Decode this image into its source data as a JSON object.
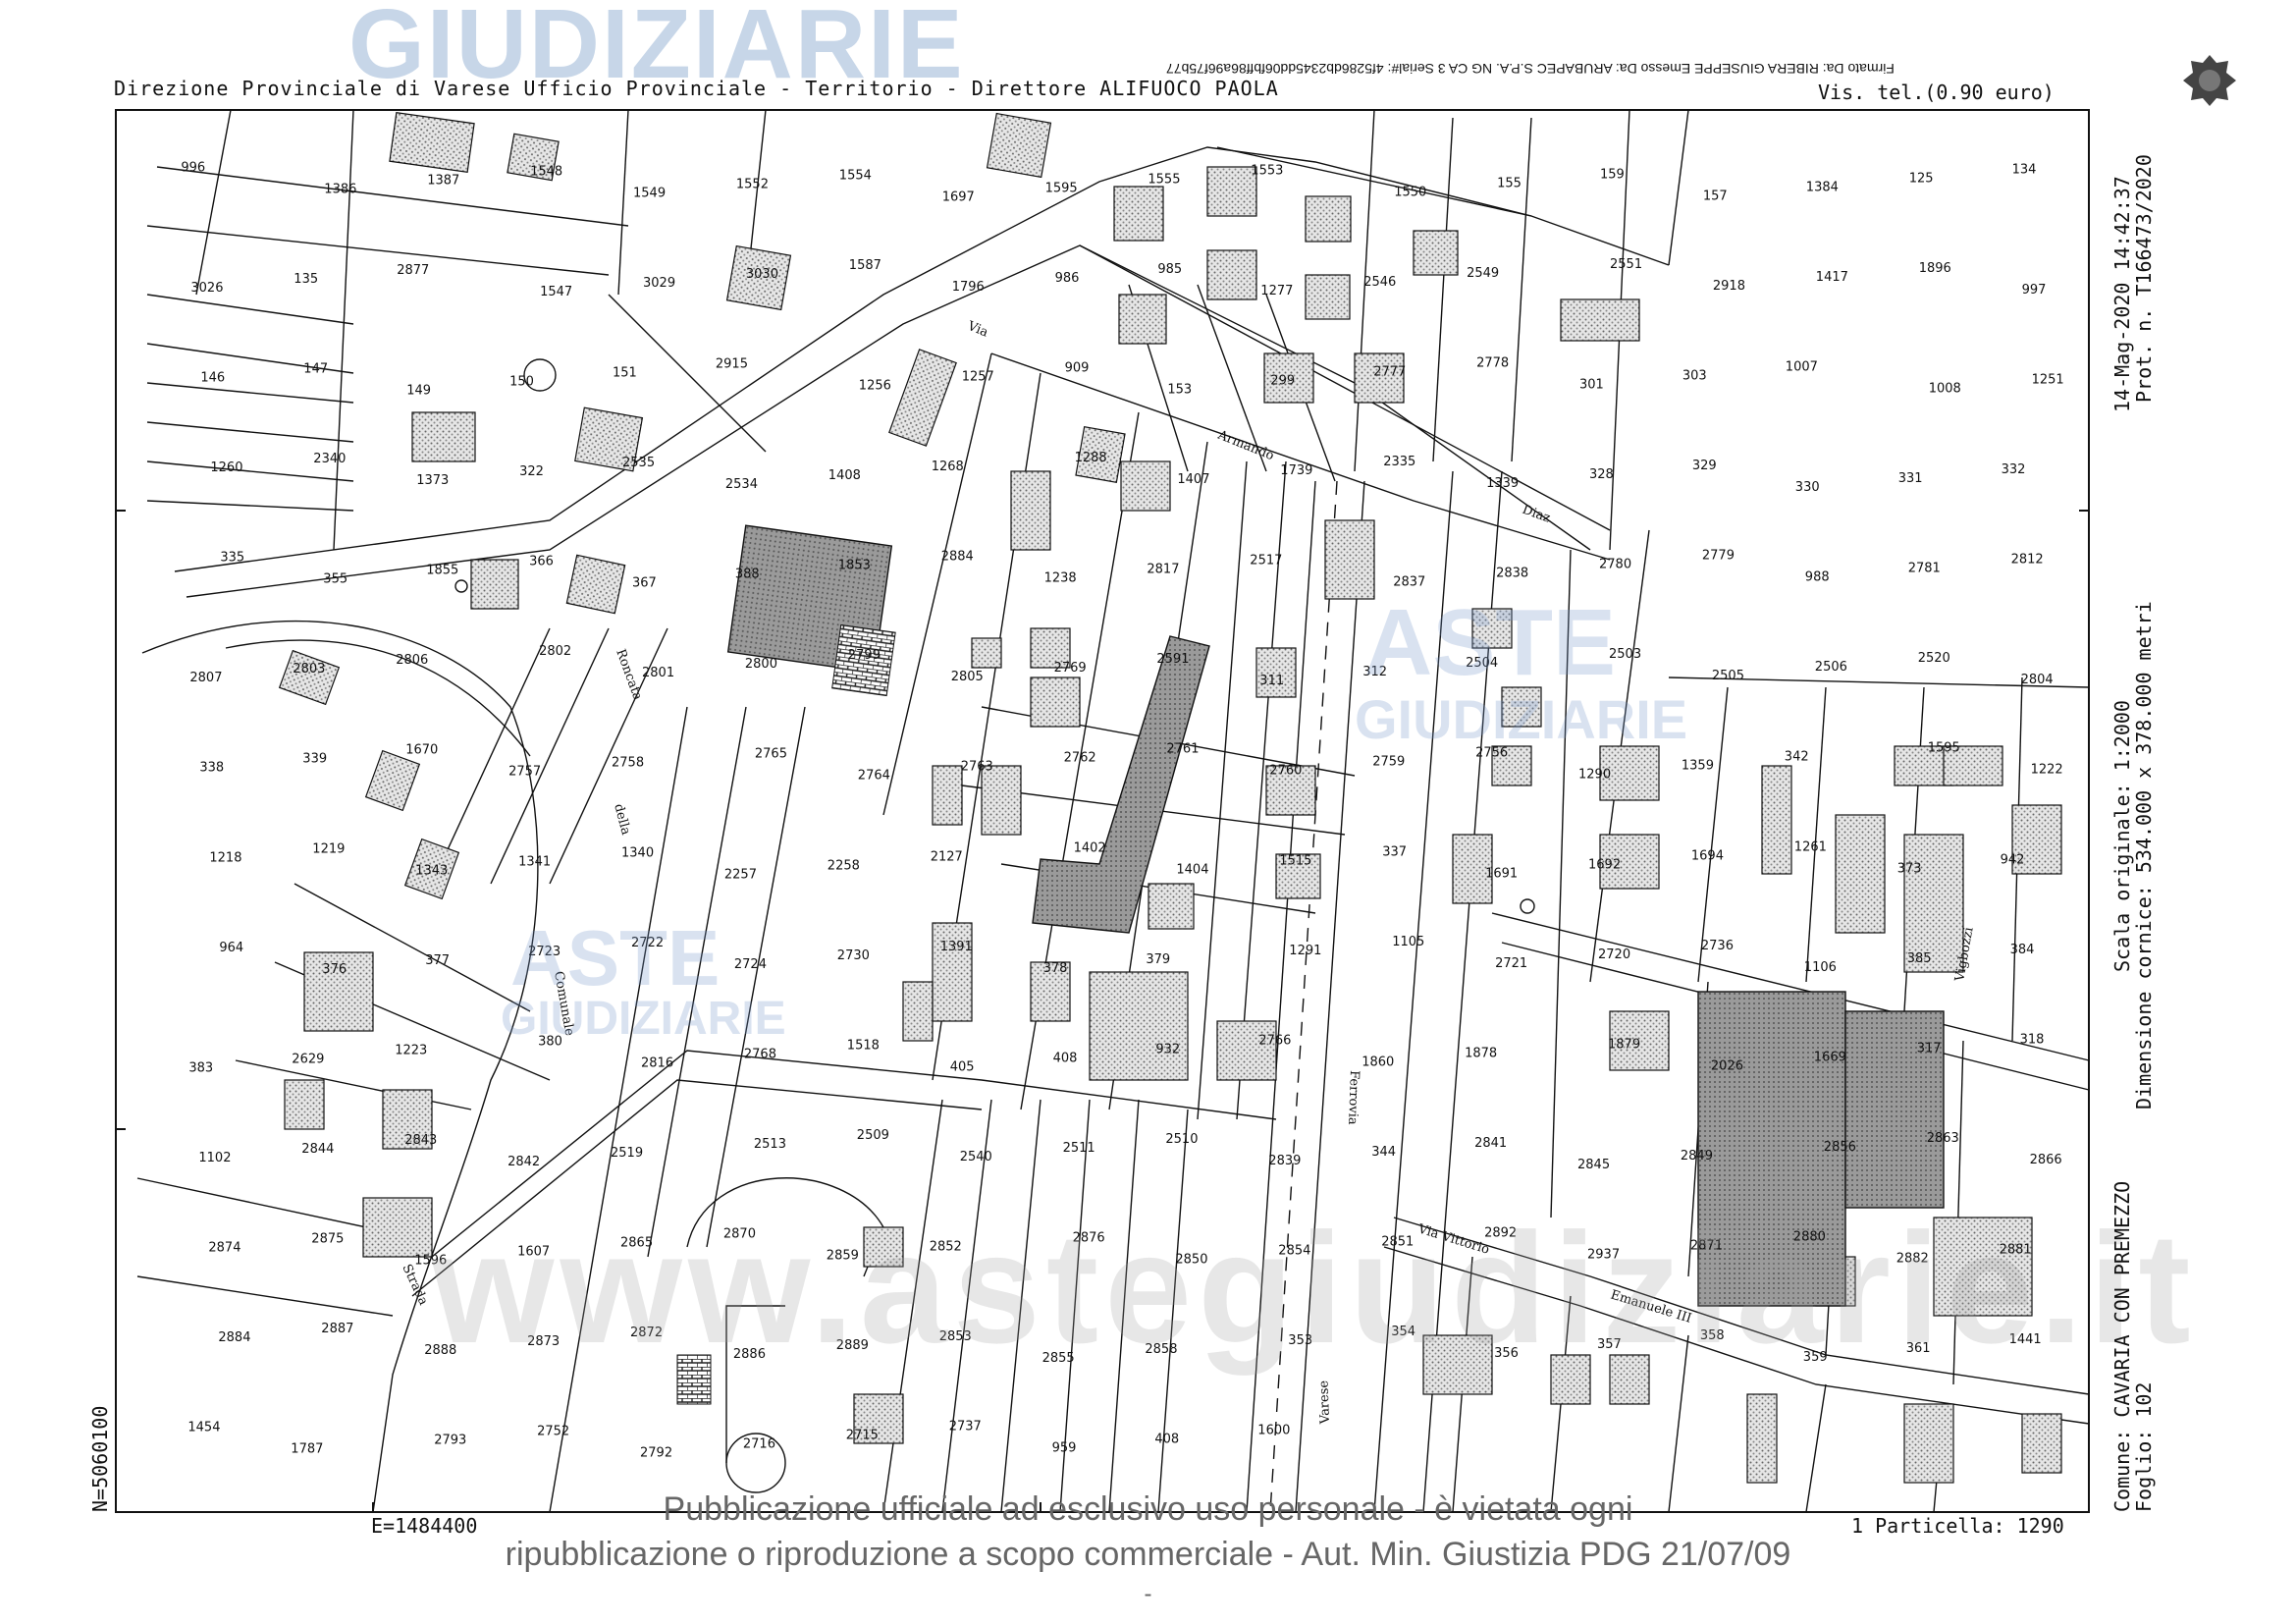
{
  "header": {
    "office": "Direzione Provinciale di Varese  Ufficio Provinciale - Territorio - Direttore ALIFUOCO PAOLA",
    "visura": "Vis. tel.(0.90 euro)",
    "signature": "Firmato Da: RIBERA GIUSEPPE Emesso Da: ARUBAPEC S.P.A. NG CA 3 Serial#: 4f5286db2345dd06fbff86a96f75b77"
  },
  "right_margin": {
    "date": "14-Mag-2020 14:42:37",
    "prot": "Prot. n. T166473/2020",
    "scale": "Scala originale: 1:2000",
    "dimension": "Dimensione cornice: 534.000 x 378.000 metri",
    "comune": "Comune: CAVARIA CON PREMEZZO",
    "foglio": "Foglio: 102"
  },
  "coords": {
    "north": "N=5060100",
    "east": "E=1484400"
  },
  "particella": "1 Particella: 1290",
  "footer": {
    "line1": "Pubblicazione ufficiale ad esclusivo uso personale - è vietata ogni",
    "line2": "ripubblicazione o riproduzione a scopo commerciale - Aut. Min. Giustizia PDG 21/07/09",
    "dash": "-"
  },
  "watermarks": {
    "top": "GIUDIZIARIE",
    "aste1": "ASTE",
    "giud1": "GIUDIZIARIE",
    "aste2": "ASTE",
    "giud2": "GIUDIZIARIE",
    "site": "www.astegiudiziarie.it"
  },
  "streets": [
    "Via Armando Diaz",
    "Roncata",
    "della",
    "Comunale",
    "Strada",
    "Ferrovia",
    "Via Vittorio Emanuele III",
    "Vigbozzi",
    "Varese"
  ],
  "parcels": [
    "996",
    "1386",
    "1387",
    "1548",
    "1549",
    "1552",
    "1554",
    "1697",
    "1595",
    "1555",
    "1553",
    "1550",
    "155",
    "159",
    "157",
    "1384",
    "125",
    "134",
    "3026",
    "135",
    "2877",
    "1547",
    "3029",
    "3030",
    "1587",
    "1796",
    "986",
    "985",
    "1277",
    "2546",
    "2549",
    "2551",
    "2918",
    "1417",
    "1896",
    "997",
    "146",
    "147",
    "149",
    "150",
    "151",
    "2915",
    "1256",
    "1257",
    "909",
    "153",
    "299",
    "2777",
    "2778",
    "301",
    "303",
    "1007",
    "1008",
    "1251",
    "1260",
    "2340",
    "1373",
    "322",
    "2535",
    "2534",
    "1408",
    "1268",
    "1288",
    "1407",
    "1739",
    "2335",
    "1339",
    "328",
    "329",
    "330",
    "331",
    "332",
    "335",
    "355",
    "1855",
    "366",
    "367",
    "388",
    "1853",
    "2884",
    "1238",
    "2817",
    "2517",
    "2837",
    "2838",
    "2780",
    "2779",
    "988",
    "2781",
    "2812",
    "2807",
    "2803",
    "2806",
    "2802",
    "2801",
    "2800",
    "2799",
    "2805",
    "2769",
    "2591",
    "311",
    "312",
    "2504",
    "2503",
    "2505",
    "2506",
    "2520",
    "2804",
    "338",
    "339",
    "1670",
    "2757",
    "2758",
    "2765",
    "2764",
    "2763",
    "2762",
    "2761",
    "2760",
    "2759",
    "2756",
    "1290",
    "1359",
    "342",
    "1595",
    "1222",
    "1218",
    "1219",
    "1343",
    "1341",
    "1340",
    "2257",
    "2258",
    "2127",
    "1402",
    "1404",
    "1515",
    "337",
    "1691",
    "1692",
    "1694",
    "1261",
    "373",
    "942",
    "964",
    "376",
    "377",
    "2723",
    "2722",
    "2724",
    "2730",
    "1391",
    "378",
    "379",
    "1291",
    "1105",
    "2721",
    "2720",
    "2736",
    "1106",
    "385",
    "384",
    "383",
    "2629",
    "1223",
    "380",
    "2816",
    "2768",
    "1518",
    "405",
    "408",
    "932",
    "2766",
    "1860",
    "1878",
    "1879",
    "2026",
    "1669",
    "317",
    "318",
    "1102",
    "2844",
    "2843",
    "2842",
    "2519",
    "2513",
    "2509",
    "2540",
    "2511",
    "2510",
    "2839",
    "344",
    "2841",
    "2845",
    "2849",
    "2856",
    "2863",
    "2866",
    "2874",
    "2875",
    "1596",
    "1607",
    "2865",
    "2870",
    "2859",
    "2852",
    "2876",
    "2850",
    "2854",
    "2851",
    "2892",
    "2937",
    "2871",
    "2880",
    "2882",
    "2881",
    "2884",
    "2887",
    "2888",
    "2873",
    "2872",
    "2886",
    "2889",
    "2853",
    "2855",
    "2858",
    "353",
    "354",
    "356",
    "357",
    "358",
    "359",
    "361",
    "1441",
    "1454",
    "1787",
    "2793",
    "2752",
    "2792",
    "2716",
    "2715",
    "2737",
    "959",
    "408",
    "1600"
  ]
}
